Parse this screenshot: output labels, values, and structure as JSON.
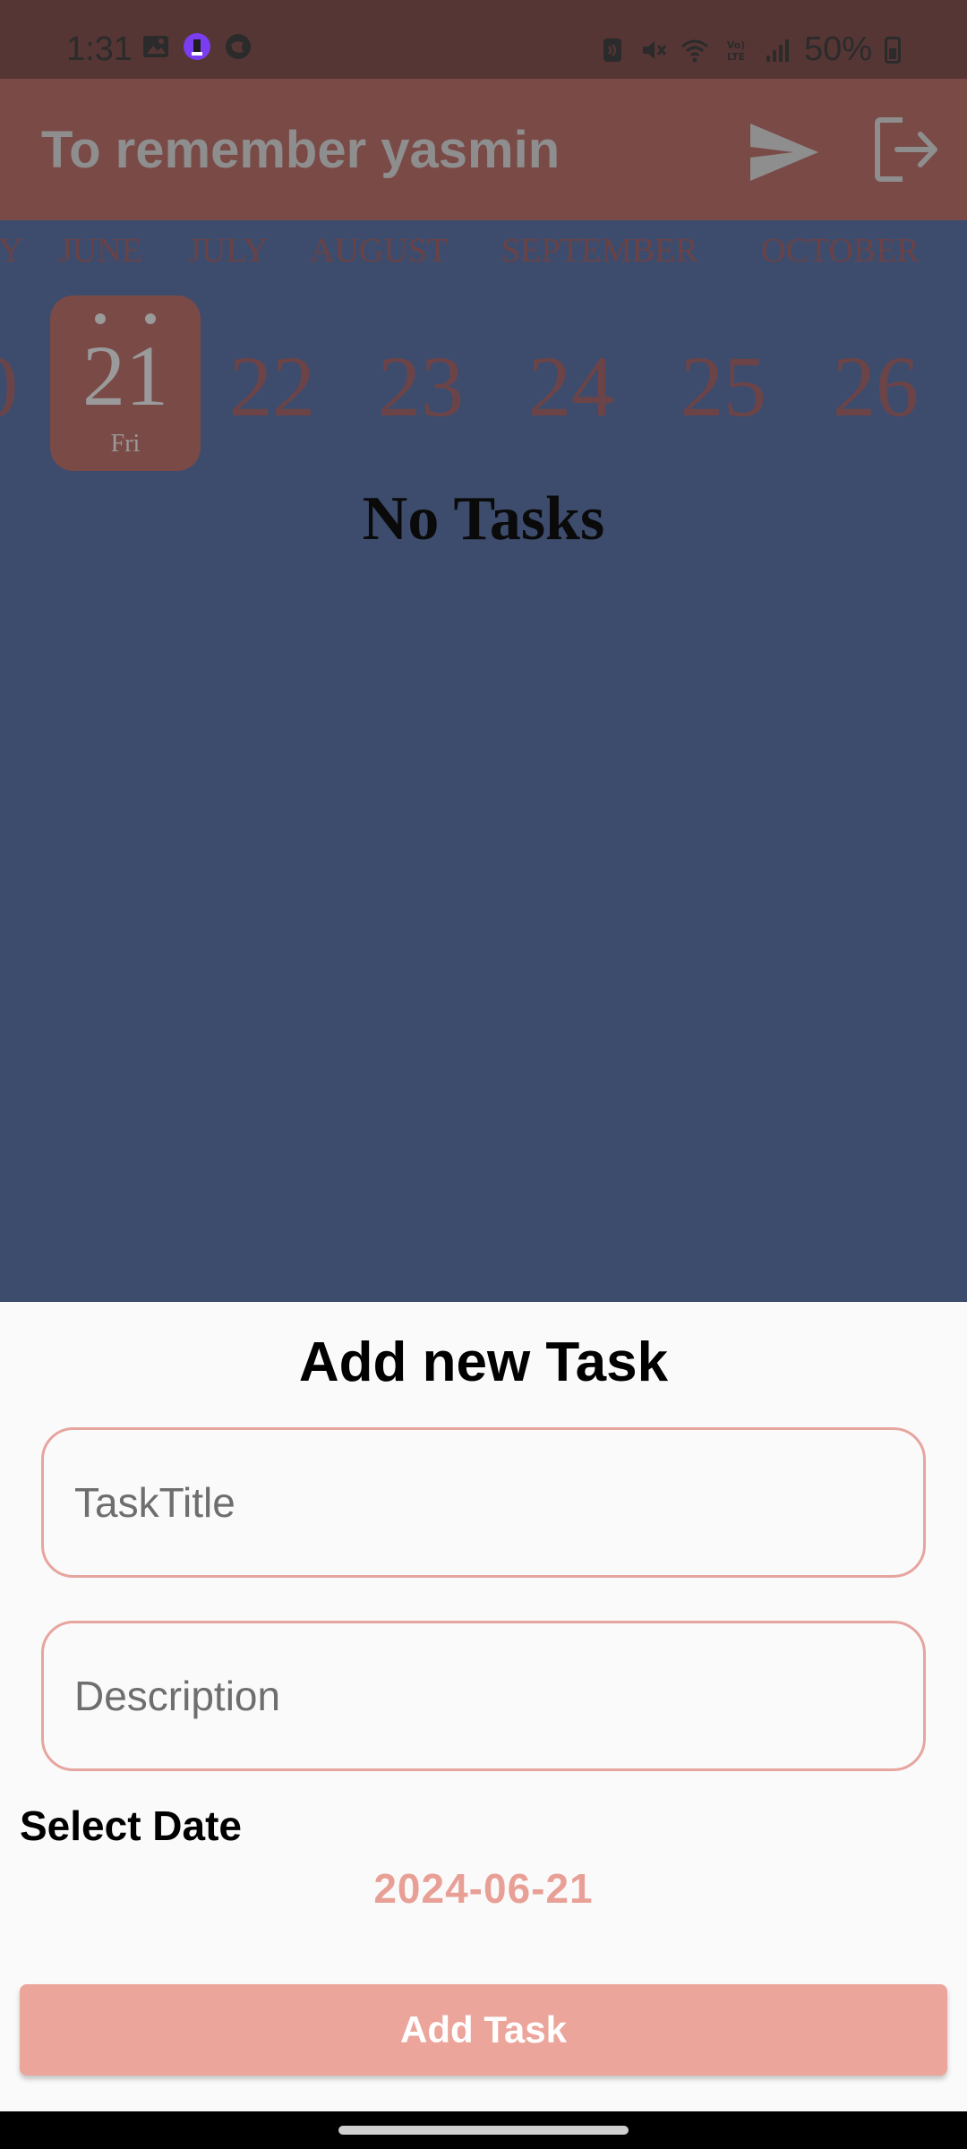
{
  "status_bar": {
    "time": "1:31",
    "battery": "50%",
    "icons_left": [
      "gallery-icon",
      "app-badge-icon",
      "browser-icon"
    ],
    "icons_right": [
      "nfc-icon",
      "mute-icon",
      "wifi-icon",
      "volte-icon",
      "signal-icon",
      "battery-icon"
    ]
  },
  "app_bar": {
    "title": "To remember   yasmin",
    "actions": [
      "send-icon",
      "logout-icon"
    ]
  },
  "calendar": {
    "months": [
      "Y",
      "JUNE",
      "JULY",
      "AUGUST",
      "SEPTEMBER",
      "OCTOBER"
    ],
    "days": [
      "0",
      "22",
      "23",
      "24",
      "25",
      "26"
    ],
    "selected_day": {
      "number": "21",
      "weekday": "Fri"
    }
  },
  "main": {
    "empty_text": "No Tasks"
  },
  "sheet": {
    "title": "Add new Task",
    "task_title_placeholder": "TaskTitle",
    "description_placeholder": "Description",
    "select_date_label": "Select Date",
    "date_value": "2024-06-21",
    "submit_label": "Add Task"
  },
  "colors": {
    "background": "#3d4c6c",
    "app_bar": "#7a4a47",
    "accent": "#eca59b",
    "sheet": "#fafafa"
  }
}
